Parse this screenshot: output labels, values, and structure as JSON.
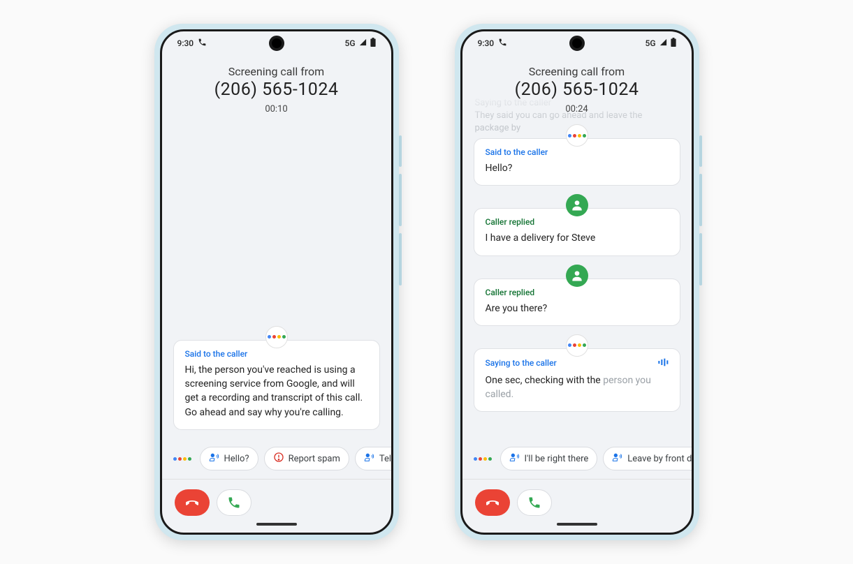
{
  "phone1": {
    "status_time": "9:30",
    "network": "5G",
    "header_title": "Screening call from",
    "header_number": "(206) 565-1024",
    "timer": "00:10",
    "card_label": "Said to the caller",
    "card_text": "Hi, the person you've reached is using a screening service from Google, and will get a recording and transcript of this call. Go ahead and say why you're calling.",
    "chips": {
      "hello": "Hello?",
      "spam": "Report spam",
      "more": "Tell me mo"
    }
  },
  "phone2": {
    "status_time": "9:30",
    "network": "5G",
    "header_title": "Screening call from",
    "header_number": "(206) 565-1024",
    "timer": "00:24",
    "faded_line1": "Saying to the caller",
    "faded_line2": "They said you can go ahead and leave the package by",
    "msgs": {
      "m1_label": "Said to the caller",
      "m1_text": "Hello?",
      "m2_label": "Caller replied",
      "m2_text": "I have a delivery for Steve",
      "m3_label": "Caller replied",
      "m3_text": "Are you there?",
      "m4_label": "Saying to the caller",
      "m4_text_pre": "One sec, checking with the ",
      "m4_text_faded": "person you called."
    },
    "chips": {
      "right_there": "I'll be right there",
      "leave_door": "Leave by front door"
    }
  }
}
